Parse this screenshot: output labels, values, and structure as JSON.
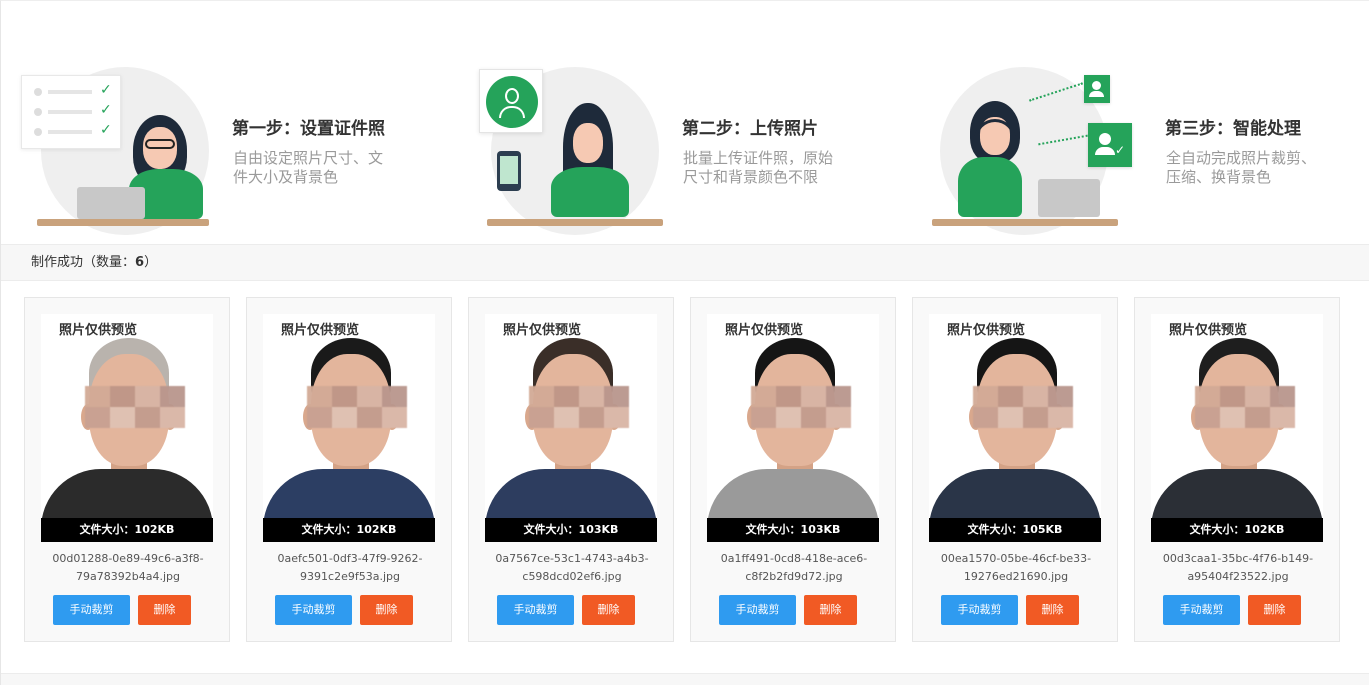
{
  "steps": [
    {
      "title": "第一步：设置证件照",
      "desc_line1": "自由设定照片尺寸、文",
      "desc_line2": "件大小及背景色"
    },
    {
      "title": "第二步：上传照片",
      "desc_line1": "批量上传证件照，原始",
      "desc_line2": "尺寸和背景颜色不限"
    },
    {
      "title": "第三步：智能处理",
      "desc_line1": "全自动完成照片裁剪、",
      "desc_line2": "压缩、换背景色"
    }
  ],
  "result": {
    "label": "制作成功（数量：",
    "count": "6",
    "suffix": "）"
  },
  "card_common": {
    "watermark": "照片仅供预览",
    "crop_label": "手动裁剪",
    "delete_label": "删除"
  },
  "cards": [
    {
      "size": "文件大小：102KB",
      "name_line1": "00d01288-0e89-49c6-a3f8-",
      "name_line2": "79a78392b4a4.jpg",
      "hair": "#b9b3ad",
      "clothes": "#2b2b2b"
    },
    {
      "size": "文件大小：102KB",
      "name_line1": "0aefc501-0df3-47f9-9262-",
      "name_line2": "9391c2e9f53a.jpg",
      "hair": "#1a1a1a",
      "clothes": "#2c3e63"
    },
    {
      "size": "文件大小：103KB",
      "name_line1": "0a7567ce-53c1-4743-a4b3-",
      "name_line2": "c598dcd02ef6.jpg",
      "hair": "#3a2e28",
      "clothes": "#2d3d5f"
    },
    {
      "size": "文件大小：103KB",
      "name_line1": "0a1ff491-0cd8-418e-ace6-",
      "name_line2": "c8f2b2fd9d72.jpg",
      "hair": "#151515",
      "clothes": "#9a9a9a"
    },
    {
      "size": "文件大小：105KB",
      "name_line1": "00ea1570-05be-46cf-be33-",
      "name_line2": "19276ed21690.jpg",
      "hair": "#151515",
      "clothes": "#2a3548"
    },
    {
      "size": "文件大小：102KB",
      "name_line1": "00d3caa1-35bc-4f76-b149-",
      "name_line2": "a95404f23522.jpg",
      "hair": "#1e1e1e",
      "clothes": "#2b2f36"
    }
  ],
  "colors": {
    "crop_button": "#2f9bf0",
    "delete_button": "#f15a24",
    "accent_green": "#25a35a"
  }
}
